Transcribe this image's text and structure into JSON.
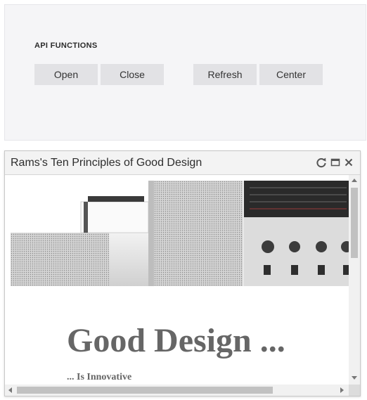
{
  "api_panel": {
    "heading": "API FUNCTIONS",
    "buttons": {
      "open": "Open",
      "close": "Close",
      "refresh": "Refresh",
      "center": "Center"
    }
  },
  "window": {
    "title": "Rams's Ten Principles of Good Design",
    "controls": [
      "refresh-icon",
      "maximize-icon",
      "close-icon"
    ]
  },
  "content": {
    "heading": "Good Design ...",
    "subheading": "... Is Innovative"
  },
  "colors": {
    "panel_bg": "#f5f5f7",
    "button_bg": "#e2e2e5",
    "heading_text": "#666666"
  }
}
